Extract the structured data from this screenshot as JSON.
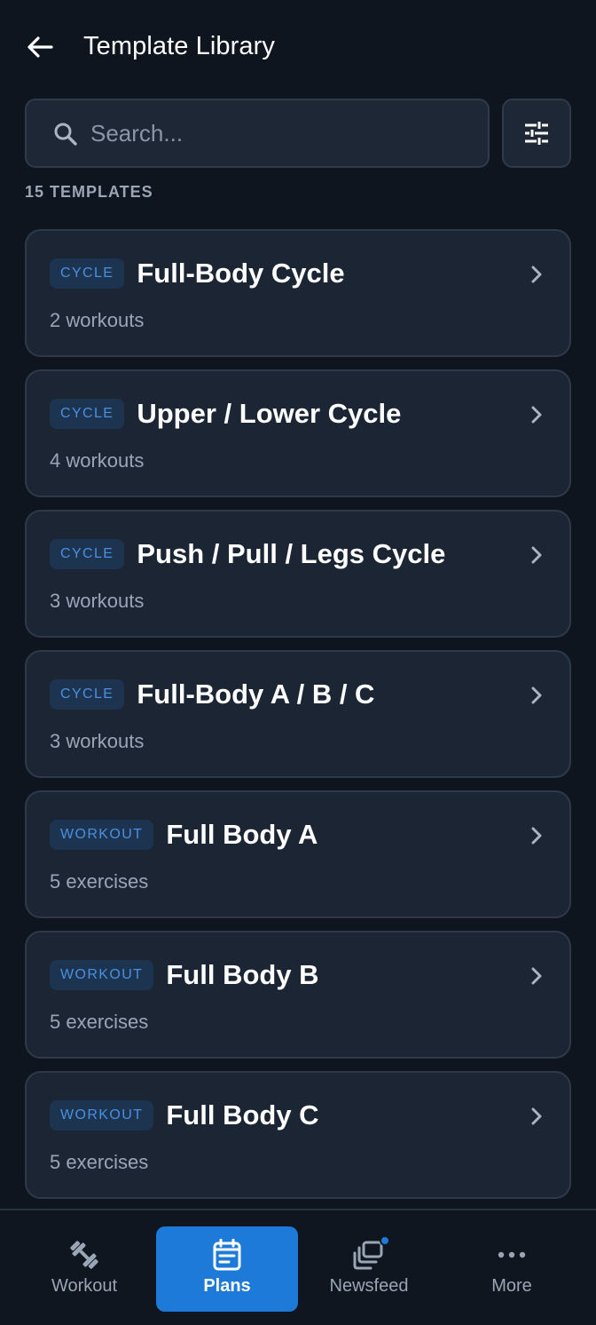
{
  "header": {
    "title": "Template Library"
  },
  "search": {
    "placeholder": "Search..."
  },
  "count_label": "15 TEMPLATES",
  "templates": [
    {
      "badge": "CYCLE",
      "title": "Full-Body Cycle",
      "subtitle": "2 workouts"
    },
    {
      "badge": "CYCLE",
      "title": "Upper / Lower Cycle",
      "subtitle": "4 workouts"
    },
    {
      "badge": "CYCLE",
      "title": "Push / Pull / Legs Cycle",
      "subtitle": "3 workouts"
    },
    {
      "badge": "CYCLE",
      "title": "Full-Body A / B / C",
      "subtitle": "3 workouts"
    },
    {
      "badge": "WORKOUT",
      "title": "Full Body A",
      "subtitle": "5 exercises"
    },
    {
      "badge": "WORKOUT",
      "title": "Full Body B",
      "subtitle": "5 exercises"
    },
    {
      "badge": "WORKOUT",
      "title": "Full Body C",
      "subtitle": "5 exercises"
    }
  ],
  "nav": [
    {
      "label": "Workout",
      "icon": "dumbbell-icon"
    },
    {
      "label": "Plans",
      "icon": "calendar-icon",
      "active": true
    },
    {
      "label": "Newsfeed",
      "icon": "newsfeed-icon"
    },
    {
      "label": "More",
      "icon": "more-icon"
    }
  ],
  "colors": {
    "background": "#0e151f",
    "card": "#1b2534",
    "accent": "#1d7ad8",
    "badge_text": "#4a8fe0",
    "muted_text": "#9aa5b6"
  }
}
